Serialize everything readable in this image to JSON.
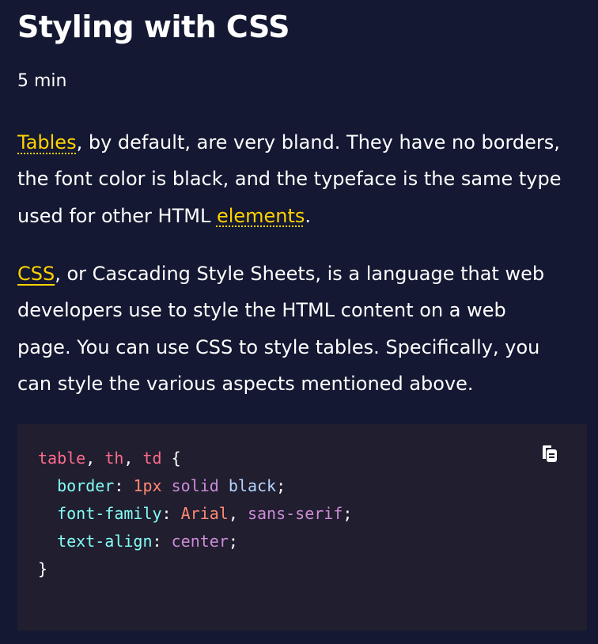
{
  "lesson": {
    "title": "Styling with CSS",
    "time": "5 min"
  },
  "paragraphs": [
    {
      "lines": [
        {
          "term": "Tables",
          "rest": ", by default, are very bland. They have no borders,"
        },
        {
          "text": "the font color is black, and the typeface is the same type"
        },
        {
          "prefix": "used for other HTML ",
          "term": "elements",
          "suffix": "."
        }
      ]
    },
    {
      "lines": [
        {
          "term": "CSS",
          "rest": ", or Cascading Style Sheets, is a language that web"
        },
        {
          "text": "developers use to style the HTML content on a web"
        },
        {
          "text": "page. You can use CSS to style tables. Specifically, you"
        },
        {
          "text": "can style the various aspects mentioned above."
        }
      ]
    }
  ],
  "code": {
    "line1": {
      "sel1": "table",
      "c1": ", ",
      "sel2": "th",
      "c2": ", ",
      "sel3": "td",
      "open": " {"
    },
    "line2": {
      "indent": "  ",
      "prop": "border",
      "colon": ": ",
      "num": "1px",
      "sp1": " ",
      "kw": "solid",
      "sp2": " ",
      "val": "black",
      "semi": ";"
    },
    "line3": {
      "indent": "  ",
      "prop": "font-family",
      "colon": ": ",
      "str": "Arial",
      "comma": ", ",
      "kw": "sans-serif",
      "semi": ";"
    },
    "line4": {
      "indent": "  ",
      "prop": "text-align",
      "colon": ": ",
      "kw": "center",
      "semi": ";"
    },
    "line5": {
      "close": "}"
    }
  },
  "icons": {
    "copy": "copy-clipboard-icon"
  },
  "colors": {
    "background": "#141832",
    "code_background": "#211e2f",
    "term_link": "#ffd300",
    "selector": "#ff6b8b",
    "property": "#83fff5",
    "number": "#ff8973",
    "keyword": "#cc8cd8",
    "value": "#b4d5ff"
  }
}
